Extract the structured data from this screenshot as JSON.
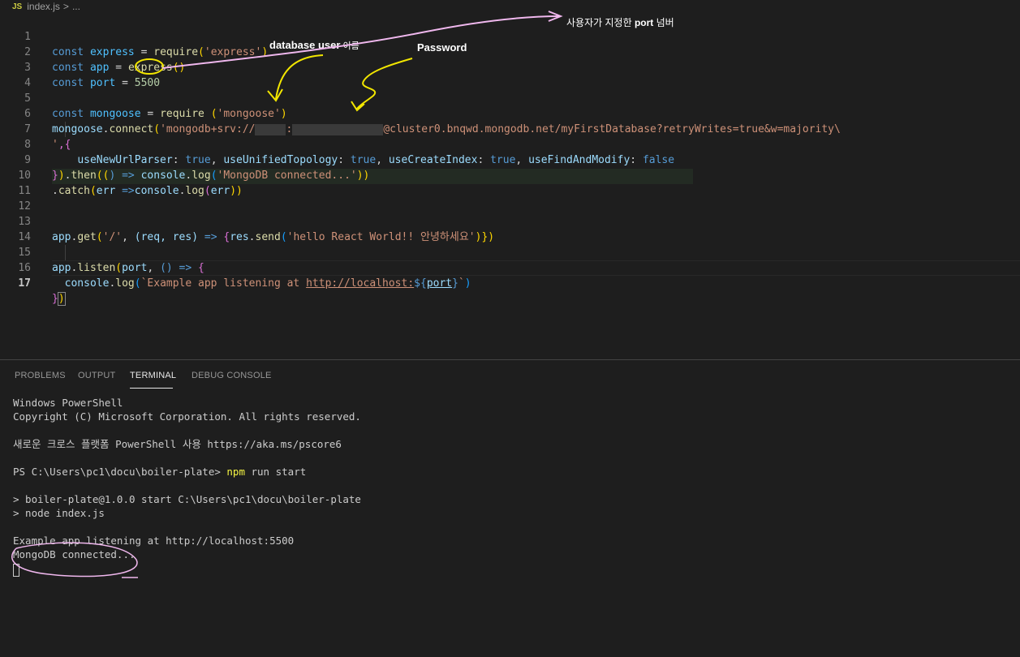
{
  "breadcrumb": {
    "file_icon": "JS",
    "file": "index.js",
    "separator": ">",
    "more": "..."
  },
  "editor": {
    "line_numbers": [
      "1",
      "2",
      "3",
      "4",
      "5",
      "6",
      "7",
      "8",
      "9",
      "10",
      "11",
      "12",
      "13",
      "14",
      "15",
      "16",
      "17"
    ],
    "l1": {
      "const": "const",
      "name": "express",
      "eq": " = ",
      "fn": "require",
      "open": "(",
      "str": "'express'",
      "close": ")"
    },
    "l2": {
      "const": "const",
      "name": "app",
      "eq": " = ",
      "fn": "express",
      "parens": "()"
    },
    "l3": {
      "const": "const",
      "name": "port",
      "eq": " = ",
      "num": "5500"
    },
    "l5": {
      "const": "const",
      "name": "mongoose",
      "eq": " = ",
      "fn": "require",
      "space_open": " (",
      "str": "'mongoose'",
      "close": ")"
    },
    "l6": {
      "obj": "mongoose",
      "dot": ".",
      "fn": "connect",
      "open": "(",
      "str_start": "'mongodb+srv://",
      "colon": ":",
      "str_end": "@cluster0.bnqwd.mongodb.net/myFirstDatabase?retryWrites=true&w=majority\\"
    },
    "l7": {
      "str": "'",
      "rest": ",{"
    },
    "l8": {
      "p1": "useNewUrlParser",
      "p2": "useUnifiedTopology",
      "p3": "useCreateIndex",
      "p4": "useFindAndModify",
      "sep": ": ",
      "comma": ", ",
      "t": "true",
      "f": "false"
    },
    "l9": {
      "close": "}",
      "paren": ")",
      "dot": ".",
      "fn": "then",
      "open": "((",
      "arrow": ") => ",
      "obj": "console",
      "log": "log",
      "str": "'MongoDB connected...'",
      "end": "))"
    },
    "l10": {
      "dot": ".",
      "fn": "catch",
      "open": "(",
      "param": "err",
      "arrow": " =>",
      "obj": "console",
      "log": "log",
      "arg": "err",
      "end": "))"
    },
    "l13": {
      "obj": "app",
      "dot": ".",
      "fn": "get",
      "open": "(",
      "str": "'/'",
      "comma": ", ",
      "params": "(req, res)",
      "arrow": " => ",
      "brace": "{",
      "res": "res",
      "send": "send",
      "str2": "'hello React World!! 안녕하세요'",
      "end": ")})"
    },
    "l15": {
      "obj": "app",
      "dot": ".",
      "fn": "listen",
      "open": "(",
      "param": "port",
      "comma": ", ",
      "arrow": "() => ",
      "brace": "{"
    },
    "l16": {
      "obj": "console",
      "dot": ".",
      "fn": "log",
      "open": "(",
      "tpl_start": "`Example app listening at ",
      "url": "http://localhost:",
      "interp_open": "${",
      "interp_var": "port",
      "interp_close": "}",
      "tpl_end": "`",
      "close": ")"
    },
    "l17": {
      "brace": "}",
      "paren": ")"
    }
  },
  "annotations": {
    "port": {
      "text": "사용자가 지정한 ",
      "bold": "port",
      "rest": " 넘버"
    },
    "user": {
      "bold": "database user",
      "rest": " 이름"
    },
    "password": {
      "bold": "Password"
    }
  },
  "panel": {
    "tabs": [
      "PROBLEMS",
      "OUTPUT",
      "TERMINAL",
      "DEBUG CONSOLE"
    ],
    "active_tab": "TERMINAL",
    "terminal": {
      "line1": "Windows PowerShell",
      "line2": "Copyright (C) Microsoft Corporation. All rights reserved.",
      "line3": "새로운 크로스 플랫폼 PowerShell 사용 https://aka.ms/pscore6",
      "prompt": "PS C:\\Users\\pc1\\docu\\boiler-plate> ",
      "cmd_npm": "npm",
      "cmd_rest": " run start",
      "line5": "> boiler-plate@1.0.0 start C:\\Users\\pc1\\docu\\boiler-plate",
      "line6": "> node index.js",
      "line7": "Example app listening at http://localhost:5500",
      "line8": "MongoDB connected..."
    }
  },
  "colors": {
    "annotation_pink": "#f0b8ee",
    "annotation_yellow": "#f2e600"
  }
}
